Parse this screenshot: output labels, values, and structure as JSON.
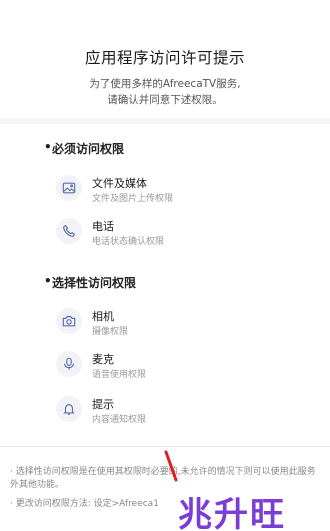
{
  "header": {
    "title": "应用程序访问许可提示",
    "desc_line1": "为了使用多样的AfreecaTV服务,",
    "desc_line2": "请确认并同意下述权限。"
  },
  "required": {
    "title": "必须访问权限",
    "bullet": "•",
    "items": [
      {
        "name": "文件及媒体",
        "desc": "文件及图片上传权限",
        "icon": "image-icon"
      },
      {
        "name": "电话",
        "desc": "电话状态确认权限",
        "icon": "phone-icon"
      }
    ]
  },
  "optional": {
    "title": "选择性访问权限",
    "bullet": "•",
    "items": [
      {
        "name": "相机",
        "desc": "摄像权限",
        "icon": "camera-icon"
      },
      {
        "name": "麦克",
        "desc": "语音使用权限",
        "icon": "microphone-icon"
      },
      {
        "name": "提示",
        "desc": "内容通知权限",
        "icon": "bell-icon"
      }
    ]
  },
  "notes": {
    "note1": "· 选择性访问权限是在使用其权限时必要的,未允许的情况下则可以使用此服务外其他功能。",
    "note2": "· 更改访问权限方法: 设定>Afreeca1"
  },
  "watermark": {
    "text": "兆升旺"
  },
  "colors": {
    "icon": "#5b6ea8",
    "watermark": "#7a3dd6",
    "redmark": "#e02020"
  }
}
